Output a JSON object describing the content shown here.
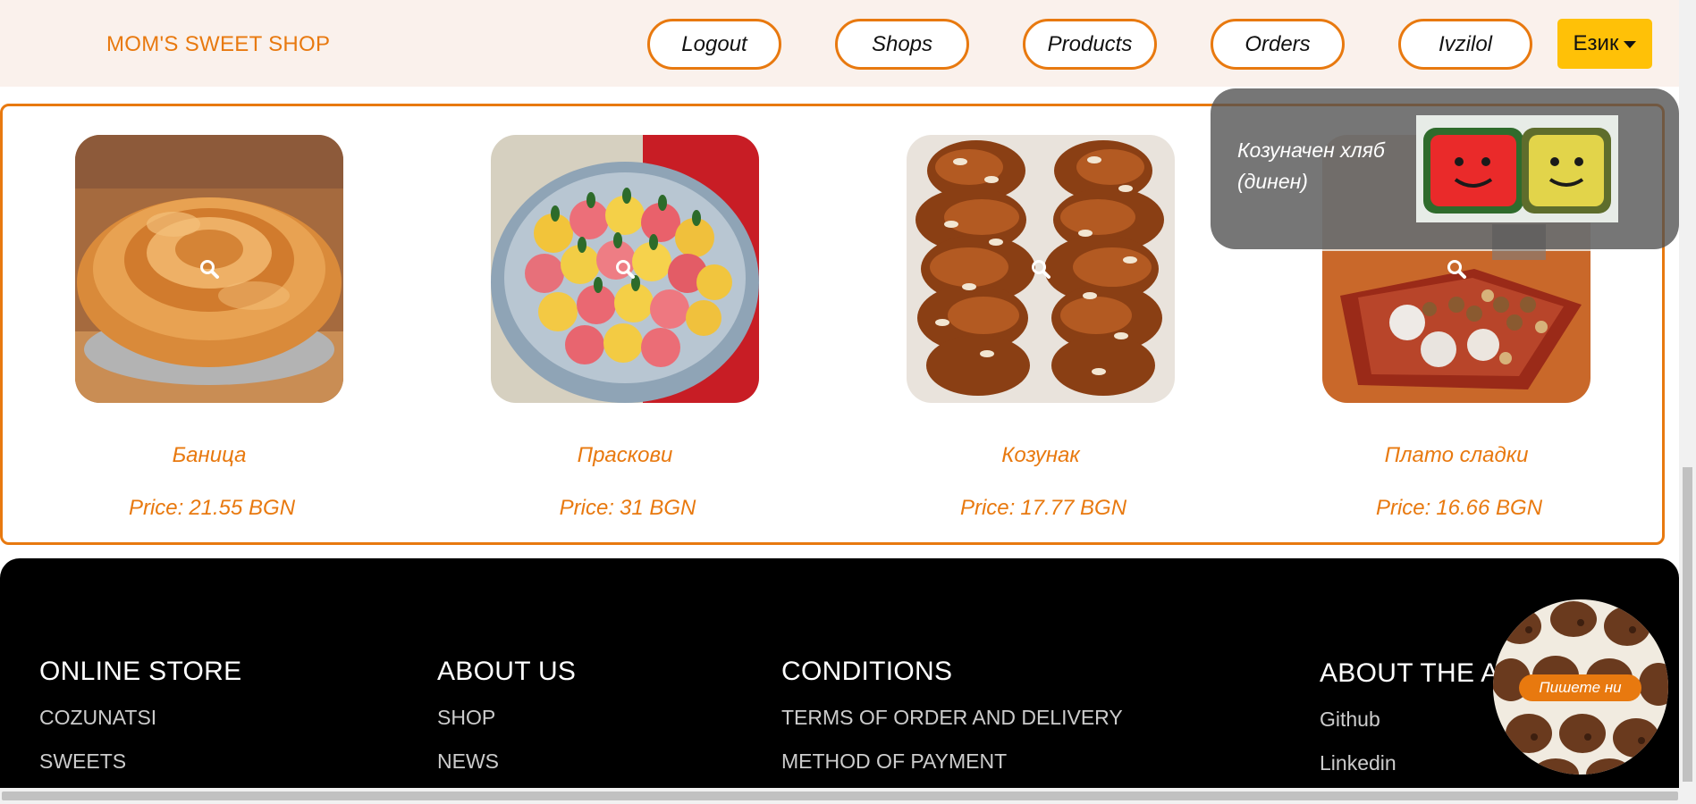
{
  "header": {
    "brand": "MOM'S SWEET SHOP",
    "nav": {
      "logout": "Logout",
      "shops": "Shops",
      "products": "Products",
      "orders": "Orders",
      "user": "Ivzilol"
    },
    "language": "Език",
    "accent_color": "#e8790f",
    "language_button_color": "#ffc107"
  },
  "products": [
    {
      "name": "Баница",
      "price_label": "Price:",
      "price": "21.55 BGN"
    },
    {
      "name": "Праскови",
      "price_label": "Price:",
      "price": "31 BGN"
    },
    {
      "name": "Козунак",
      "price_label": "Price:",
      "price": "17.77 BGN"
    },
    {
      "name": "Плато сладки",
      "price_label": "Price:",
      "price": "16.66 BGN"
    }
  ],
  "popup": {
    "text": "Козуначен хляб (динен)"
  },
  "footer": {
    "online_store": {
      "title": "ONLINE STORE",
      "links": [
        "COZUNATSI",
        "SWEETS"
      ]
    },
    "about_us": {
      "title": "ABOUT US",
      "links": [
        "SHOP",
        "NEWS"
      ]
    },
    "conditions": {
      "title": "CONDITIONS",
      "links": [
        "TERMS OF ORDER AND DELIVERY",
        "METHOD OF PAYMENT"
      ]
    },
    "about_app": {
      "title": "ABOUT THE AP",
      "links": [
        "Github",
        "Linkedin"
      ]
    }
  },
  "chat": {
    "label": "Пишете ни"
  },
  "icons": [
    "search-icon",
    "caret-down-icon"
  ]
}
